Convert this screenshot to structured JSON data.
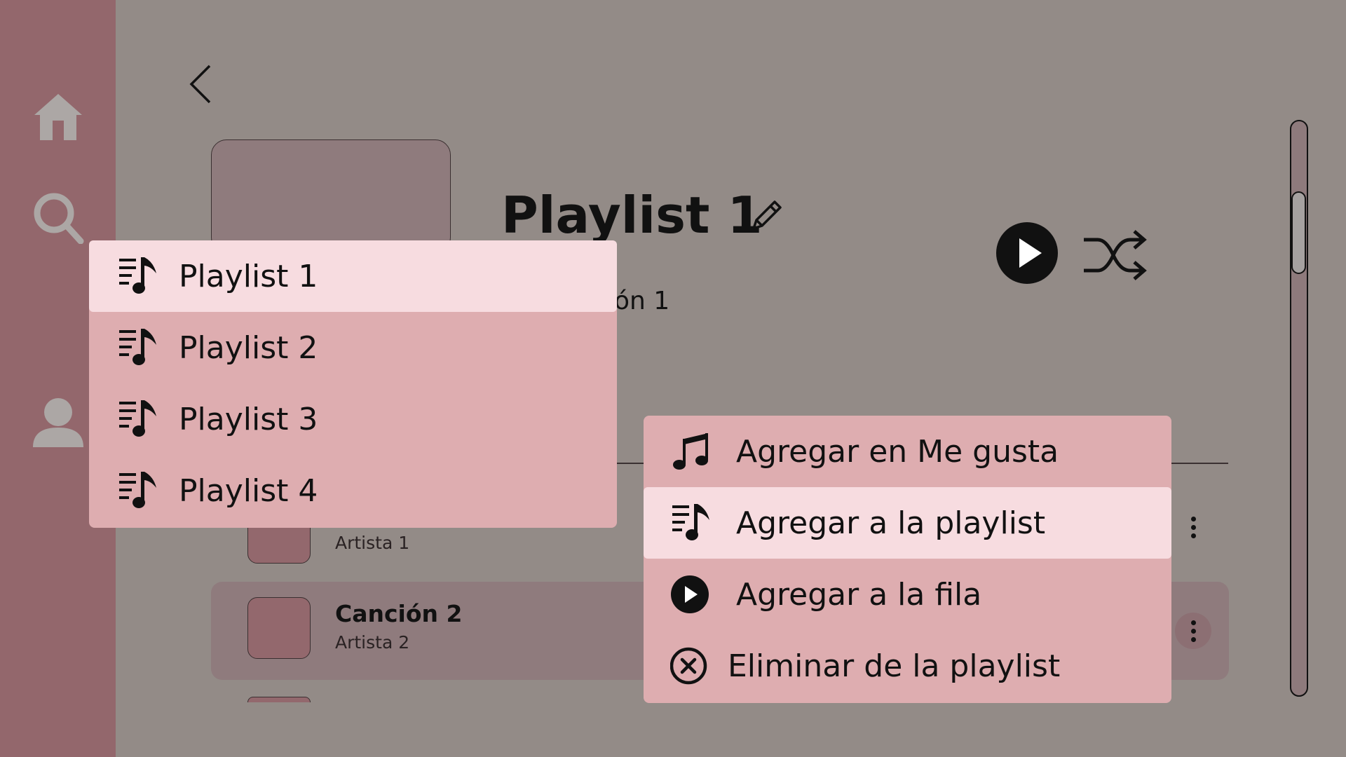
{
  "sidebar": {
    "items": [
      {
        "icon": "home-icon"
      },
      {
        "icon": "search-icon"
      },
      {
        "icon": "profile-icon"
      }
    ]
  },
  "header": {
    "back_icon": "chevron-left-icon",
    "title": "Playlist 1",
    "edit_icon": "pencil-icon",
    "subtitle_partial": "ión 1",
    "play_icon": "play-circle-icon",
    "shuffle_icon": "shuffle-icon"
  },
  "tracks": [
    {
      "title": "",
      "artist": "Artista 1"
    },
    {
      "title": "Canción 2",
      "artist": "Artista 2"
    }
  ],
  "playlist_menu": {
    "items": [
      {
        "label": "Playlist 1",
        "icon": "playlist-music-icon",
        "highlighted": true
      },
      {
        "label": "Playlist 2",
        "icon": "playlist-music-icon",
        "highlighted": false
      },
      {
        "label": "Playlist 3",
        "icon": "playlist-music-icon",
        "highlighted": false
      },
      {
        "label": "Playlist 4",
        "icon": "playlist-music-icon",
        "highlighted": false
      }
    ]
  },
  "context_menu": {
    "items": [
      {
        "label": "Agregar en Me gusta",
        "icon": "music-note-icon",
        "highlighted": false
      },
      {
        "label": "Agregar a la playlist",
        "icon": "playlist-music-icon",
        "highlighted": true
      },
      {
        "label": "Agregar a la fila",
        "icon": "play-circle-icon",
        "highlighted": false
      },
      {
        "label": "Eliminar de la playlist",
        "icon": "remove-circle-icon",
        "highlighted": false
      }
    ]
  },
  "colors": {
    "background": "#938b87",
    "sidebar": "#93676c",
    "menu": "#deadb0",
    "menu_highlight": "#f7dce0",
    "row_selected": "#8f7b7d"
  }
}
